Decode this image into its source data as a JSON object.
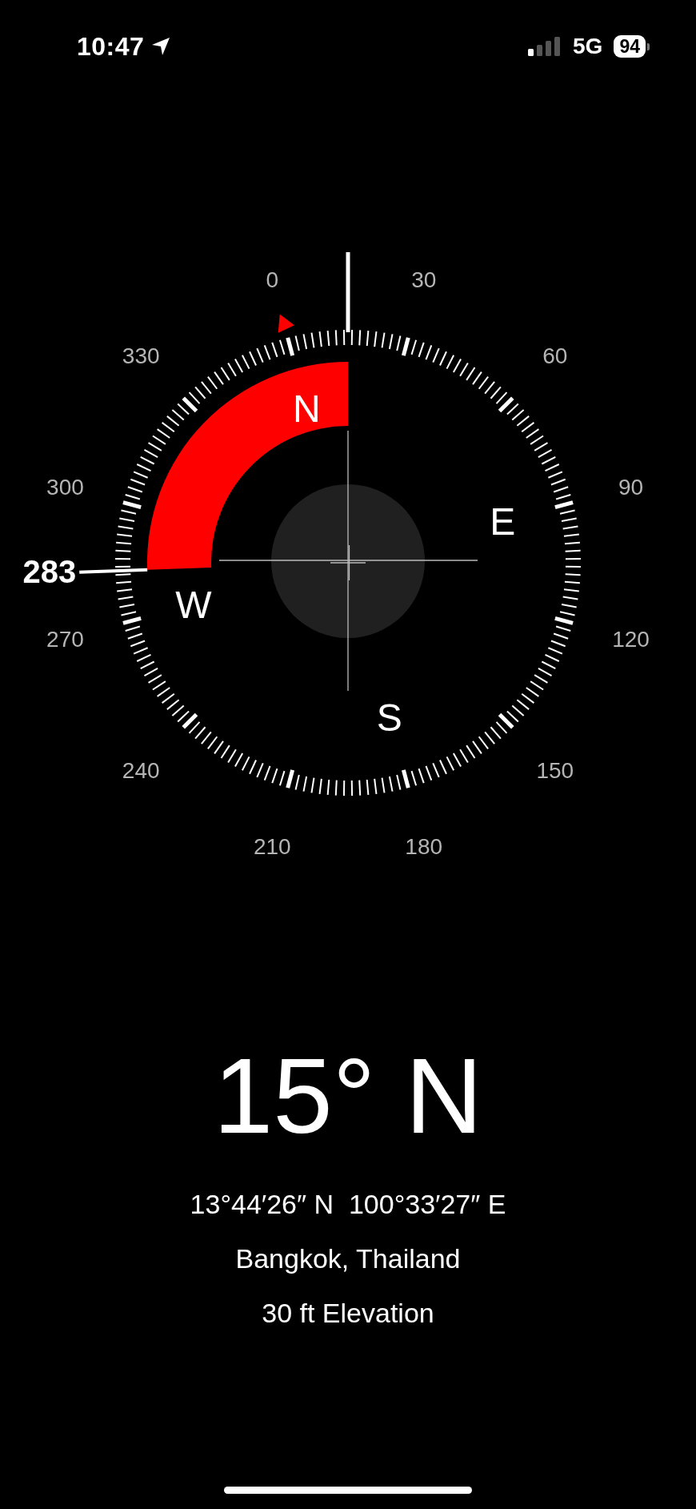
{
  "status_bar": {
    "time": "10:47",
    "network": "5G",
    "battery": "94"
  },
  "compass": {
    "dial_labels": [
      "0",
      "30",
      "60",
      "90",
      "120",
      "150",
      "180",
      "210",
      "240",
      "270",
      "300",
      "330"
    ],
    "cardinal_labels": [
      "N",
      "E",
      "S",
      "W"
    ],
    "bearing_marker": "283"
  },
  "heading": "15° N",
  "coordinates": "13°44′26″ N  100°33′27″ E",
  "location": "Bangkok, Thailand",
  "elevation": "30 ft Elevation"
}
